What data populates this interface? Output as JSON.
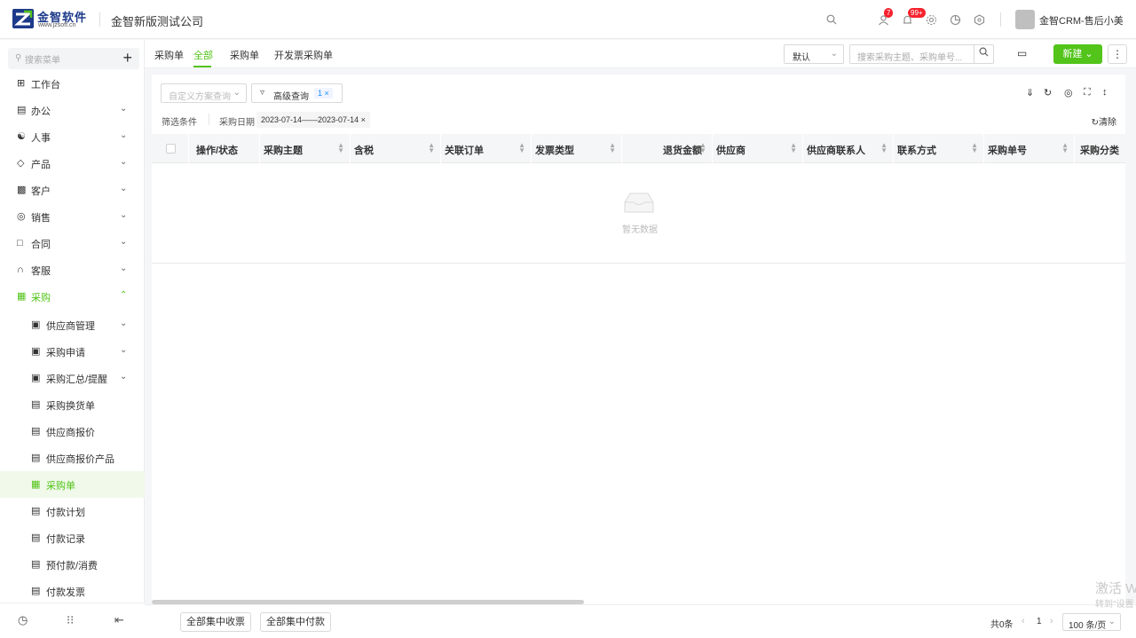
{
  "header": {
    "brand": "金智软件",
    "brand_url": "www.jzsoft.cn",
    "company": "金智新版测试公司",
    "contacts_badge": "7",
    "notifications_badge": "99+",
    "user_name": "金智CRM-售后小美"
  },
  "sidebar": {
    "search_placeholder": "搜索菜单",
    "items": [
      {
        "label": "工作台",
        "icon": "grid-icon"
      },
      {
        "label": "办公",
        "icon": "monitor-icon"
      },
      {
        "label": "人事",
        "icon": "people-icon"
      },
      {
        "label": "产品",
        "icon": "box-icon"
      },
      {
        "label": "客户",
        "icon": "chart-icon"
      },
      {
        "label": "销售",
        "icon": "target-icon"
      },
      {
        "label": "合同",
        "icon": "document-icon"
      },
      {
        "label": "客服",
        "icon": "headset-icon"
      },
      {
        "label": "采购",
        "icon": "cart-icon"
      }
    ],
    "sub_items": [
      {
        "label": "供应商管理"
      },
      {
        "label": "采购申请"
      },
      {
        "label": "采购汇总/提醒"
      },
      {
        "label": "采购换货单"
      },
      {
        "label": "供应商报价"
      },
      {
        "label": "供应商报价产品"
      },
      {
        "label": "采购单"
      },
      {
        "label": "付款计划"
      },
      {
        "label": "付款记录"
      },
      {
        "label": "预付款/消费"
      },
      {
        "label": "付款发票"
      }
    ]
  },
  "toolbar": {
    "title": "采购单",
    "tabs": [
      "全部",
      "采购单",
      "开发票采购单"
    ],
    "view_select": "默认",
    "search_placeholder": "搜索采购主题、采购单号...",
    "new_label": "新建"
  },
  "filters": {
    "custom_placeholder": "自定义方案查询",
    "advanced_label": "高级查询",
    "advanced_count": "1 ×",
    "conditions_label": "筛选条件",
    "condition_key": "采购日期",
    "condition_value": "2023-07-14——2023-07-14 ×",
    "clear_label": "清除"
  },
  "table": {
    "columns": [
      "操作/状态",
      "采购主题",
      "含税",
      "关联订单",
      "发票类型",
      "退货金额",
      "供应商",
      "供应商联系人",
      "联系方式",
      "采购单号",
      "采购分类"
    ],
    "empty_text": "暂无数据"
  },
  "footer": {
    "btn_receive": "全部集中收票",
    "btn_pay": "全部集中付款",
    "total": "共0条",
    "page": "1",
    "page_size": "100 条/页"
  },
  "watermark": {
    "line1": "激活 W",
    "line2": "转到\"设置"
  },
  "colors": {
    "accent": "#52c41a",
    "badge": "#f5222d"
  }
}
